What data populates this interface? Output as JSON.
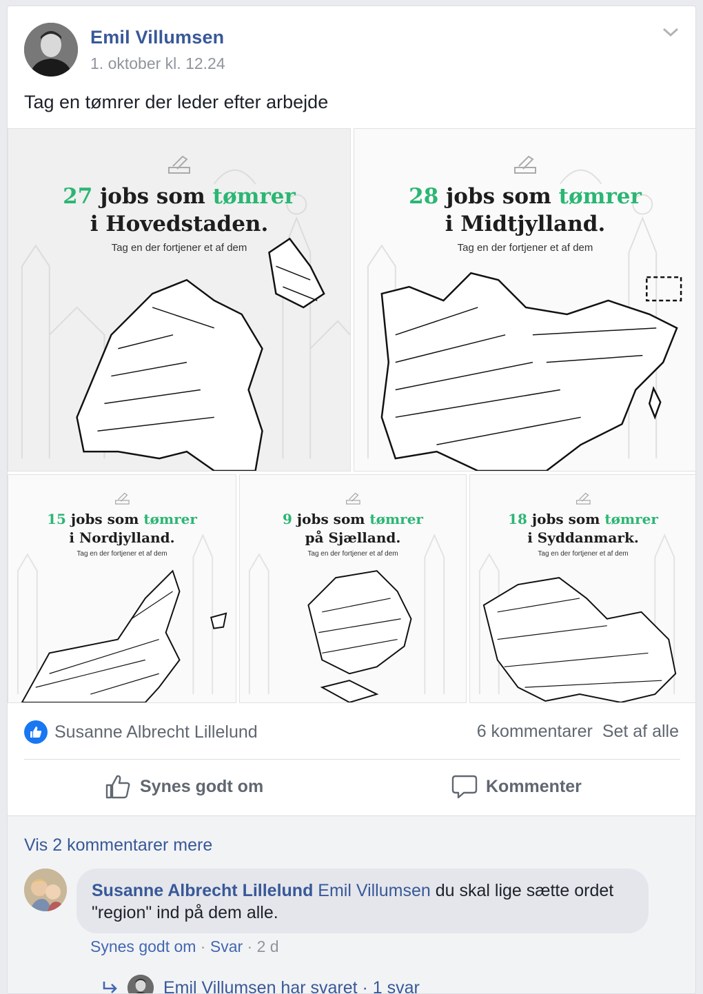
{
  "post": {
    "author": "Emil Villumsen",
    "timestamp": "1. oktober kl. 12.24",
    "text": "Tag en tømrer der leder efter arbejde"
  },
  "images": [
    {
      "count": "27",
      "mid": " jobs som ",
      "word": "tømrer",
      "line2": "i Hovedstaden.",
      "subtitle": "Tag en der fortjener et af dem"
    },
    {
      "count": "28",
      "mid": " jobs som ",
      "word": "tømrer",
      "line2": "i Midtjylland.",
      "subtitle": "Tag en der fortjener et af dem"
    },
    {
      "count": "15",
      "mid": " jobs som ",
      "word": "tømrer",
      "line2": "i Nordjylland.",
      "subtitle": "Tag en der fortjener et af dem"
    },
    {
      "count": "9",
      "mid": " jobs som ",
      "word": "tømrer",
      "line2": "på Sjælland.",
      "subtitle": "Tag en der fortjener et af dem"
    },
    {
      "count": "18",
      "mid": " jobs som ",
      "word": "tømrer",
      "line2": "i Syddanmark.",
      "subtitle": "Tag en der fortjener et af dem"
    }
  ],
  "reactions": {
    "liker": "Susanne Albrecht Lillelund",
    "comments_count": "6 kommentarer",
    "see_all": "Set af alle"
  },
  "actions": {
    "like": "Synes godt om",
    "comment": "Kommenter"
  },
  "comments": {
    "view_more": "Vis 2 kommentarer mere",
    "first": {
      "author": "Susanne Albrecht Lillelund",
      "mention": "Emil Villumsen",
      "text": " du skal lige sætte ordet \"region\" ind på dem alle.",
      "like": "Synes godt om",
      "sep1": " · ",
      "reply": "Svar",
      "sep2": " · ",
      "age": "2 d"
    },
    "replies_summary": "Emil Villumsen har svaret · 1 svar"
  },
  "colors": {
    "link": "#385898",
    "accent_green": "#2bb673",
    "like_blue": "#1877f2",
    "muted": "#606770"
  }
}
